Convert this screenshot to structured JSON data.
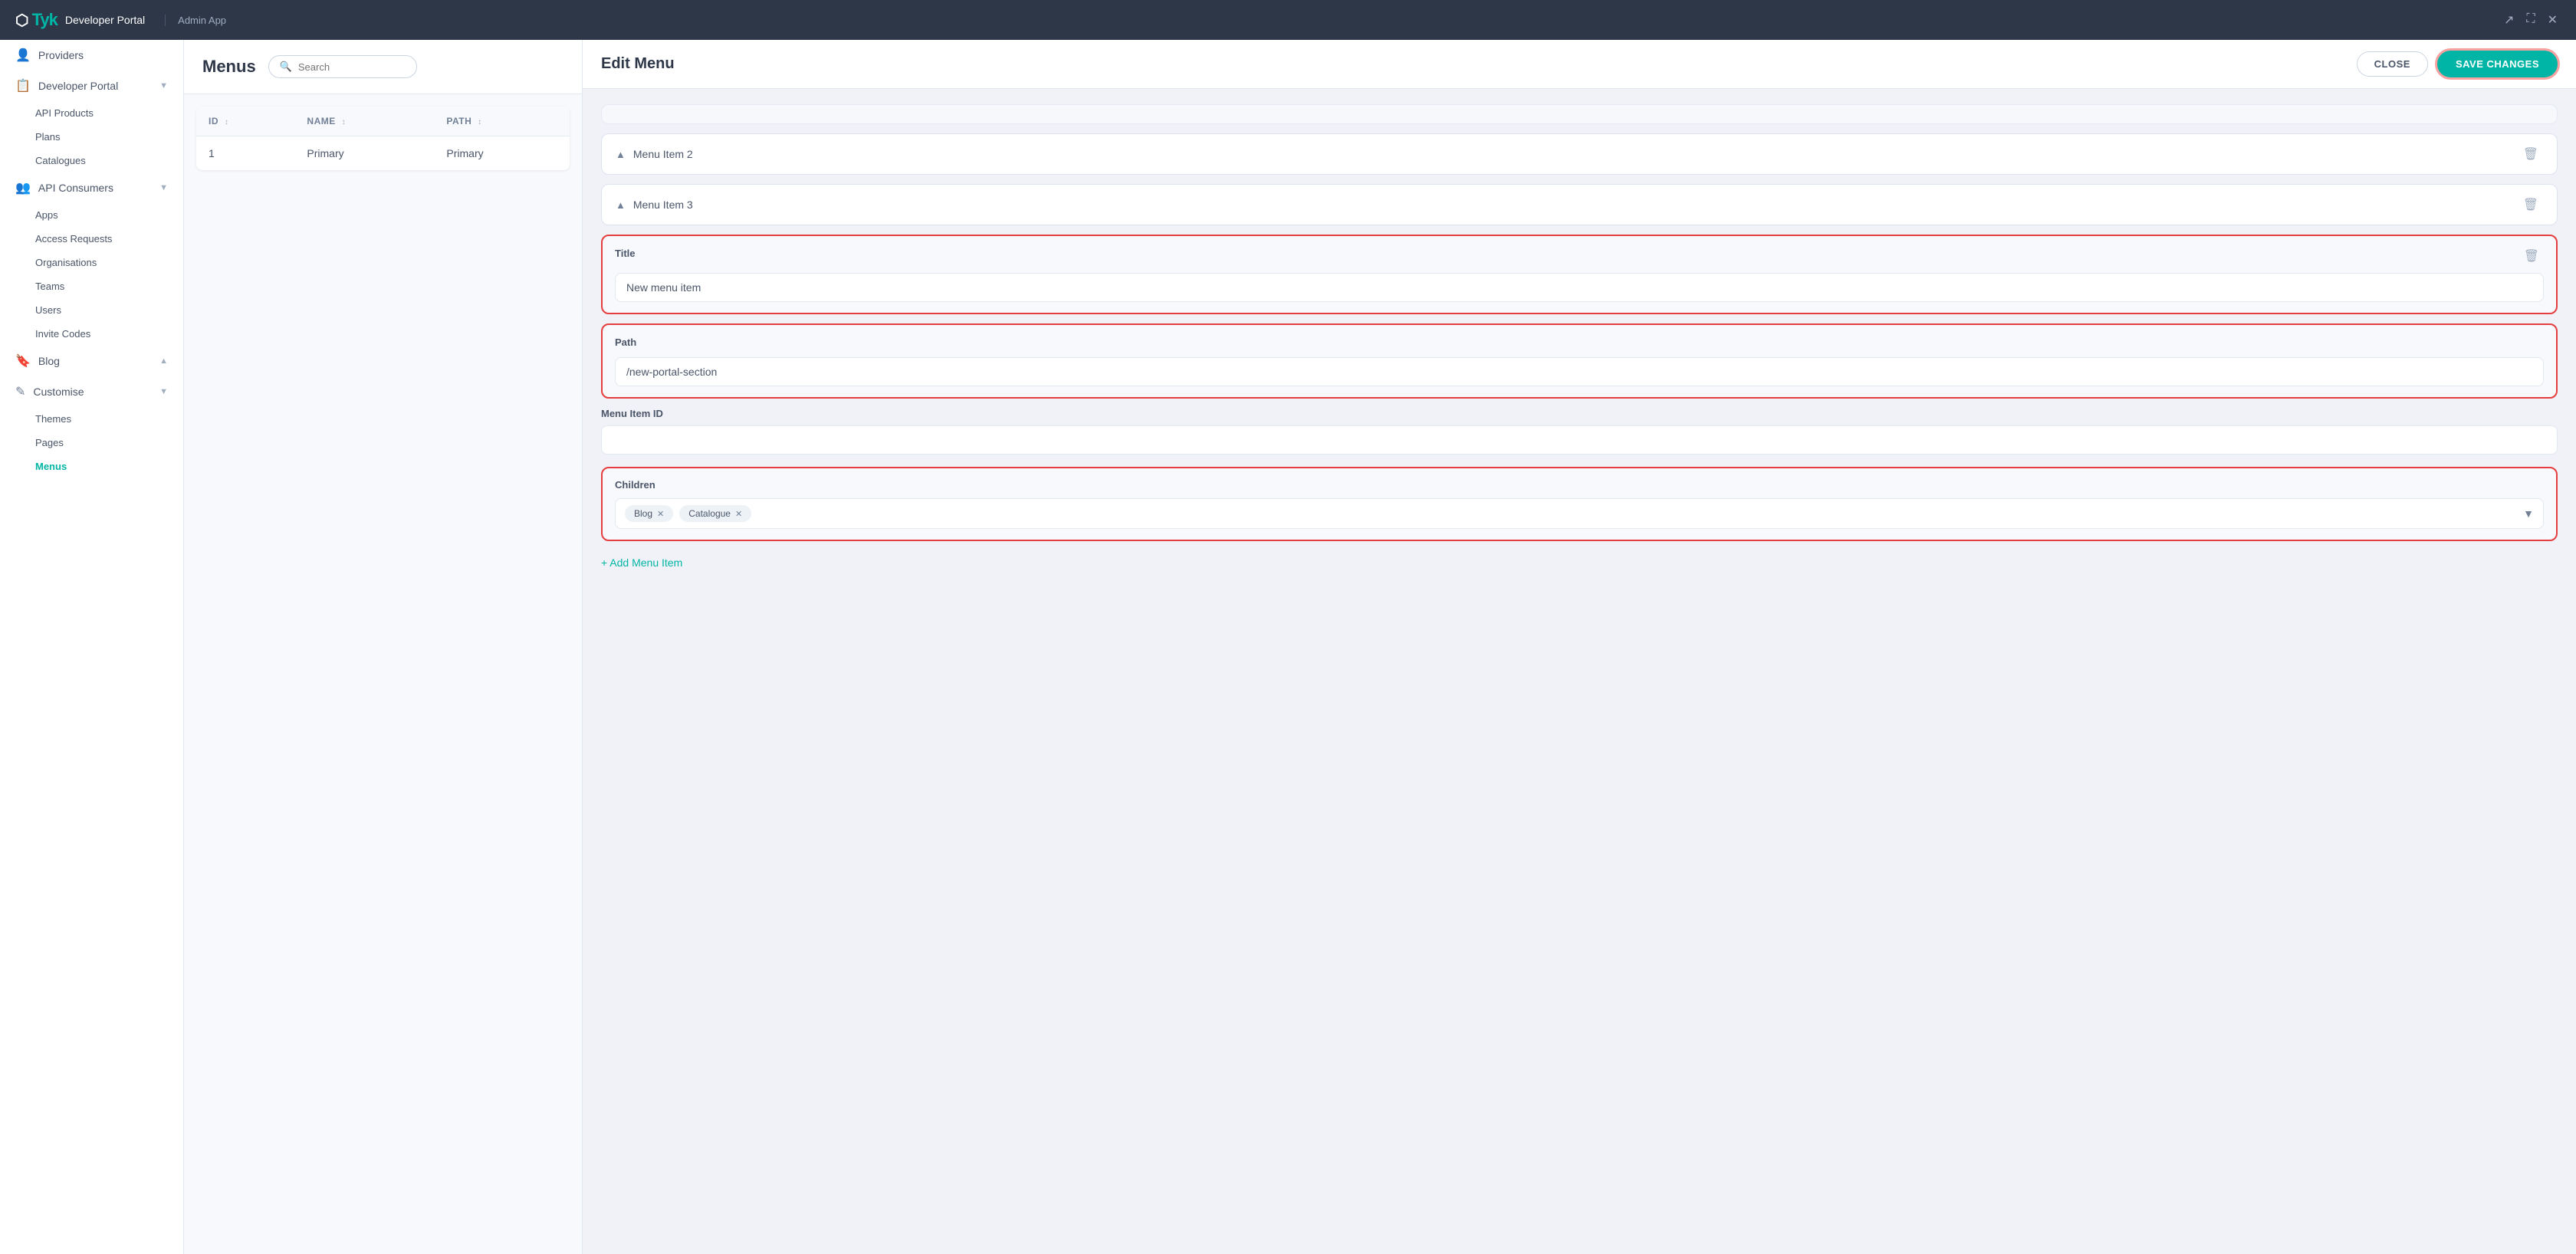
{
  "header": {
    "logo": "Tyk",
    "logo_sub": "Developer Portal",
    "app_name": "Admin App",
    "window_icons": [
      "external-link-icon",
      "maximize-icon",
      "close-icon"
    ]
  },
  "sidebar": {
    "items": [
      {
        "id": "providers",
        "label": "Providers",
        "icon": "person-icon",
        "expandable": false
      },
      {
        "id": "developer-portal",
        "label": "Developer Portal",
        "icon": "portal-icon",
        "expandable": true
      },
      {
        "id": "api-products",
        "label": "API Products",
        "parent": "developer-portal"
      },
      {
        "id": "plans",
        "label": "Plans",
        "parent": "developer-portal"
      },
      {
        "id": "catalogues",
        "label": "Catalogues",
        "parent": "developer-portal"
      },
      {
        "id": "api-consumers",
        "label": "API Consumers",
        "icon": "consumers-icon",
        "expandable": true
      },
      {
        "id": "apps",
        "label": "Apps",
        "parent": "api-consumers"
      },
      {
        "id": "access-requests",
        "label": "Access Requests",
        "parent": "api-consumers"
      },
      {
        "id": "organisations",
        "label": "Organisations",
        "parent": "api-consumers"
      },
      {
        "id": "teams",
        "label": "Teams",
        "parent": "api-consumers"
      },
      {
        "id": "users",
        "label": "Users",
        "parent": "api-consumers"
      },
      {
        "id": "invite-codes",
        "label": "Invite Codes",
        "parent": "api-consumers"
      },
      {
        "id": "blog",
        "label": "Blog",
        "icon": "blog-icon",
        "expandable": true
      },
      {
        "id": "customise",
        "label": "Customise",
        "icon": "customise-icon",
        "expandable": true
      },
      {
        "id": "themes",
        "label": "Themes",
        "parent": "customise"
      },
      {
        "id": "pages",
        "label": "Pages",
        "parent": "customise"
      },
      {
        "id": "menus",
        "label": "Menus",
        "parent": "customise",
        "active": true
      }
    ]
  },
  "menus_panel": {
    "title": "Menus",
    "search_placeholder": "Search",
    "table": {
      "columns": [
        {
          "key": "id",
          "label": "ID",
          "sortable": true
        },
        {
          "key": "name",
          "label": "NAME",
          "sortable": true
        },
        {
          "key": "path",
          "label": "PATH",
          "sortable": true
        }
      ],
      "rows": [
        {
          "id": "1",
          "name": "Primary",
          "path": "Primary"
        }
      ]
    }
  },
  "edit_panel": {
    "title": "Edit Menu",
    "btn_close": "CLOSE",
    "btn_save": "SAVE CHANGES",
    "menu_items": [
      {
        "id": "item1",
        "label": "Menu Item 2",
        "expanded": false
      },
      {
        "id": "item2",
        "label": "Menu Item 3",
        "expanded": false
      }
    ],
    "active_item": {
      "title_label": "Title",
      "title_value": "New menu item",
      "title_placeholder": "New menu item",
      "path_label": "Path",
      "path_value": "/new-portal-section",
      "path_placeholder": "/new-portal-section",
      "menu_item_id_label": "Menu Item ID",
      "menu_item_id_value": "",
      "children_label": "Children",
      "children_tags": [
        {
          "label": "Blog"
        },
        {
          "label": "Catalogue"
        }
      ]
    },
    "add_menu_item_label": "+ Add Menu Item"
  }
}
